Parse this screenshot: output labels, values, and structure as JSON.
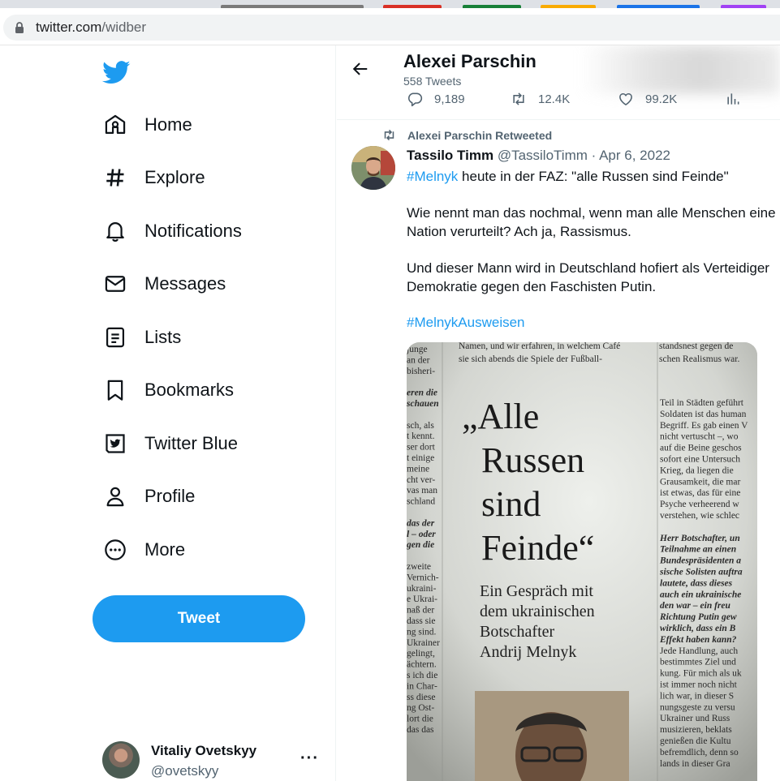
{
  "browser": {
    "url_host": "twitter.com",
    "url_path": "/widber",
    "tab_colors": [
      "#7a7a7a",
      "#d93025",
      "#188038",
      "#f9ab00",
      "#1a73e8",
      "#a142f4"
    ]
  },
  "sidebar": {
    "items": [
      {
        "label": "Home",
        "icon": "home-icon"
      },
      {
        "label": "Explore",
        "icon": "hashtag-icon"
      },
      {
        "label": "Notifications",
        "icon": "bell-icon"
      },
      {
        "label": "Messages",
        "icon": "envelope-icon"
      },
      {
        "label": "Lists",
        "icon": "list-icon"
      },
      {
        "label": "Bookmarks",
        "icon": "bookmark-icon"
      },
      {
        "label": "Twitter Blue",
        "icon": "twitter-blue-icon"
      },
      {
        "label": "Profile",
        "icon": "person-icon"
      },
      {
        "label": "More",
        "icon": "more-circle-icon"
      }
    ],
    "tweet_button": "Tweet",
    "account": {
      "name": "Vitaliy Ovetskyy",
      "handle": "@ovetskyy",
      "menu": "···"
    }
  },
  "header": {
    "name": "Alexei Parschin",
    "tweet_count": "558 Tweets",
    "stats": {
      "replies": "9,189",
      "retweets": "12.4K",
      "likes": "99.2K"
    }
  },
  "tweet": {
    "retweeted_by": "Alexei Parschin Retweeted",
    "author_name": "Tassilo Timm",
    "author_handle": "@TassiloTimm",
    "separator": "·",
    "date": "Apr 6, 2022",
    "hashtag1": "#Melnyk",
    "line1_rest": " heute in der FAZ: \"alle Russen sind Feinde\"",
    "line2": "Wie nennt man das nochmal, wenn man alle Menschen eine",
    "line3": "Nation verurteilt? Ach ja, Rassismus.",
    "line4": "Und dieser Mann wird in Deutschland hofiert als Verteidiger",
    "line5": "Demokratie gegen den Faschisten Putin.",
    "hashtag2": "#MelnykAusweisen"
  },
  "photo": {
    "headline_lines": [
      "„Alle",
      "Russen",
      "sind",
      "Feinde“"
    ],
    "subhead_lines": [
      "Ein Gespräch mit",
      "dem ukrainischen",
      "Botschafter",
      "Andrij Melnyk"
    ],
    "top_lines": [
      "Namen, und wir erfahren, in welchem Café",
      "sie sich abends die Spiele der Fußball-"
    ],
    "top_right_lines": [
      "standsnest gegen de",
      "schen Realismus war."
    ],
    "left_col_lines": [
      "junge",
      "an der",
      "bisheri-",
      "",
      "eren die",
      "schauen",
      "",
      "sch, als",
      "t kennt.",
      "ser dort",
      "t einige",
      "meine",
      "cht ver-",
      "vas man",
      "schland",
      "",
      "das der",
      "l – oder",
      "gen die",
      "",
      "zweite",
      "Vernich-",
      "ukraini-",
      "e Ukrai-",
      "naß der",
      "dass sie",
      "ng sind.",
      "Ukrainer",
      "gelingt,",
      "ächtern.",
      "s ich die",
      "in Char-",
      "ss diese",
      "ng Ost-",
      "lort die",
      "das das"
    ],
    "right_col_lines": [
      "Teil in Städten geführt",
      "Soldaten ist das human",
      "Begriff. Es gab einen V",
      "nicht vertuscht –, wo",
      "auf die Beine geschos",
      "sofort eine Untersuch",
      "Krieg, da liegen die",
      "Grausamkeit, die mar",
      "ist etwas, das für eine",
      "Psyche verheerend w",
      "verstehen, wie schlec",
      "",
      "Herr Botschafter, un",
      "Teilnahme an einen",
      "Bundespräsidenten a",
      "sische Solisten auftra",
      "lautete, dass dieses",
      "auch ein ukrainische",
      "den war – ein freu",
      "Richtung Putin gew",
      "wirklich, dass ein B",
      "Effekt haben kann?",
      "Jede Handlung, auch",
      "bestimmtes Ziel und",
      "kung. Für mich als uk",
      "ist immer noch nicht",
      "lich war, in dieser S",
      "nungsgeste zu versu",
      "Ukrainer und Russ",
      "musizieren, beklats",
      "genießen die Kultu",
      "befremdlich, denn so",
      "lands in dieser Gra"
    ]
  }
}
